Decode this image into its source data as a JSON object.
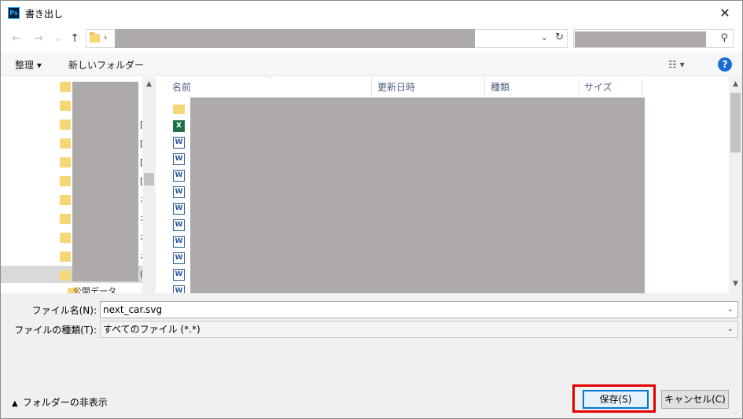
{
  "window": {
    "title": "書き出し",
    "app_icon_text": "Ps"
  },
  "toolbar": {
    "back": "←",
    "forward": "→",
    "recent": "⌄",
    "up": "↑",
    "address_chevron": "›",
    "address_dropdown": "⌄",
    "refresh": "↻",
    "search_glyph": "⚲"
  },
  "commandbar": {
    "organize": "整理 ▾",
    "new_folder": "新しいフォルダー",
    "view": "☷ ▾",
    "help": "?"
  },
  "navpane": {
    "side_chars": [
      "[",
      "[",
      "[",
      "[",
      "ネ",
      "ネ",
      "ネ",
      "ネ",
      "ネ",
      "("
    ],
    "bottom_text": "公開データ"
  },
  "filelist": {
    "columns": [
      "名前",
      "更新日時",
      "種類",
      "サイズ"
    ],
    "sort_glyph": "^",
    "rows": [
      "folder",
      "excel",
      "word",
      "word",
      "word",
      "word",
      "word",
      "word",
      "word",
      "word",
      "word",
      "word"
    ]
  },
  "form": {
    "filename_label": "ファイル名(N):",
    "filename_value": "next_car.svg",
    "filetype_label": "ファイルの種類(T):",
    "filetype_value": "すべてのファイル (*.*)",
    "hide_folders": "フォルダーの非表示",
    "save_button": "保存(S)",
    "cancel_button": "キャンセル(C)"
  },
  "colors": {
    "highlight": "#e30000",
    "primary_border": "#0078d7",
    "redaction": "#aeaaa9"
  }
}
